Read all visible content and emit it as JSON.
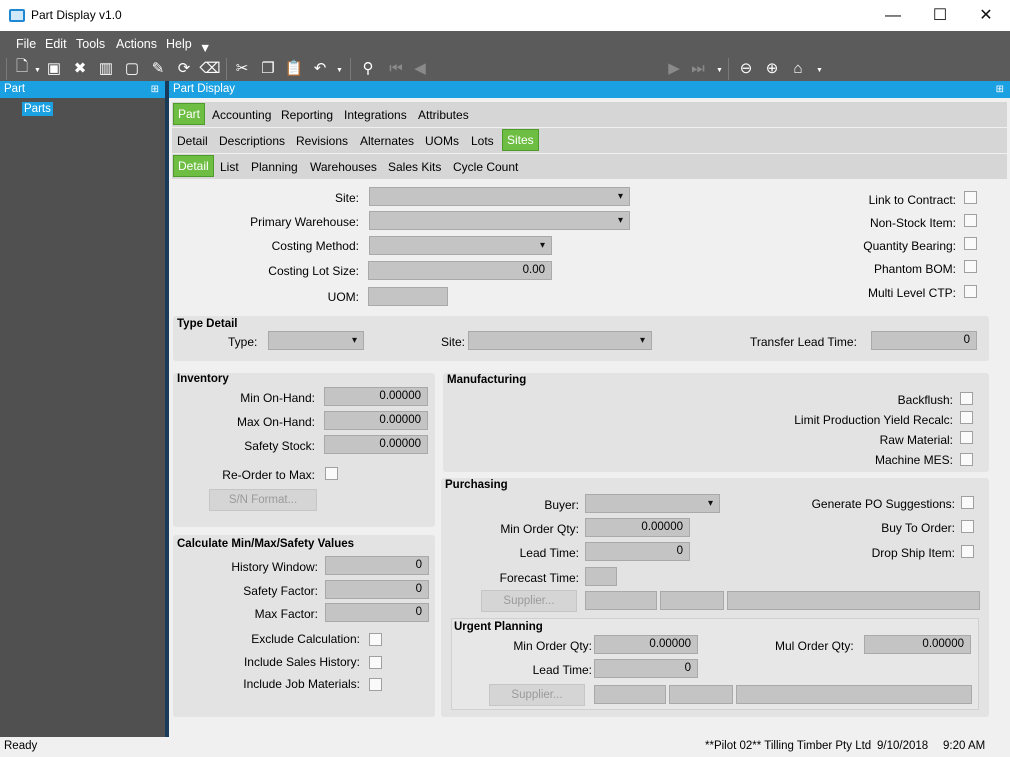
{
  "window": {
    "title": "Part Display v1.0",
    "minimize": "—",
    "maximize": "☐",
    "close": "✕"
  },
  "menu": [
    "File",
    "Edit",
    "Tools",
    "Actions",
    "Help"
  ],
  "left_panel": {
    "title": "Part",
    "item": "Parts"
  },
  "main_panel": {
    "title": "Part Display"
  },
  "tabs_top": [
    "Part",
    "Accounting",
    "Reporting",
    "Integrations",
    "Attributes"
  ],
  "tabs_mid": [
    "Detail",
    "Descriptions",
    "Revisions",
    "Alternates",
    "UOMs",
    "Lots",
    "Sites"
  ],
  "tabs_sub": [
    "Detail",
    "List",
    "Planning",
    "Warehouses",
    "Sales Kits",
    "Cycle Count"
  ],
  "site_fields": {
    "site": "Site:",
    "primary_warehouse": "Primary Warehouse:",
    "costing_method": "Costing Method:",
    "costing_lot_size": "Costing Lot Size:",
    "costing_lot_size_value": "0.00",
    "uom": "UOM:"
  },
  "flags": {
    "link_to_contract": "Link to Contract:",
    "non_stock_item": "Non-Stock Item:",
    "quantity_bearing": "Quantity Bearing:",
    "phantom_bom": "Phantom BOM:",
    "multi_level_ctp": "Multi Level CTP:"
  },
  "type_detail": {
    "title": "Type Detail",
    "type": "Type:",
    "site": "Site:",
    "transfer_lead_time": "Transfer Lead Time:",
    "transfer_lead_time_value": "0"
  },
  "inventory": {
    "title": "Inventory",
    "min_on_hand": "Min On-Hand:",
    "min_on_hand_value": "0.00000",
    "max_on_hand": "Max On-Hand:",
    "max_on_hand_value": "0.00000",
    "safety_stock": "Safety Stock:",
    "safety_stock_value": "0.00000",
    "reorder_to_max": "Re-Order to Max:",
    "sn_format": "S/N Format..."
  },
  "calc": {
    "title": "Calculate Min/Max/Safety Values",
    "history_window": "History Window:",
    "history_window_value": "0",
    "safety_factor": "Safety Factor:",
    "safety_factor_value": "0",
    "max_factor": "Max Factor:",
    "max_factor_value": "0",
    "exclude_calculation": "Exclude Calculation:",
    "include_sales_history": "Include Sales History:",
    "include_job_materials": "Include Job Materials:"
  },
  "manufacturing": {
    "title": "Manufacturing",
    "backflush": "Backflush:",
    "limit_production_yield_recalc": "Limit Production Yield Recalc:",
    "raw_material": "Raw Material:",
    "machine_mes": "Machine MES:"
  },
  "purchasing": {
    "title": "Purchasing",
    "buyer": "Buyer:",
    "min_order_qty": "Min Order Qty:",
    "min_order_qty_value": "0.00000",
    "lead_time": "Lead Time:",
    "lead_time_value": "0",
    "forecast_time": "Forecast Time:",
    "supplier": "Supplier...",
    "generate_po_suggestions": "Generate PO Suggestions:",
    "buy_to_order": "Buy To Order:",
    "drop_ship_item": "Drop Ship Item:"
  },
  "urgent": {
    "title": "Urgent Planning",
    "min_order_qty": "Min Order Qty:",
    "min_order_qty_value": "0.00000",
    "mul_order_qty": "Mul Order Qty:",
    "mul_order_qty_value": "0.00000",
    "lead_time": "Lead Time:",
    "lead_time_value": "0",
    "supplier": "Supplier..."
  },
  "status": {
    "text": "Ready",
    "company": "**Pilot 02** Tilling Timber Pty Ltd",
    "date": "9/10/2018",
    "time": "9:20 AM"
  }
}
